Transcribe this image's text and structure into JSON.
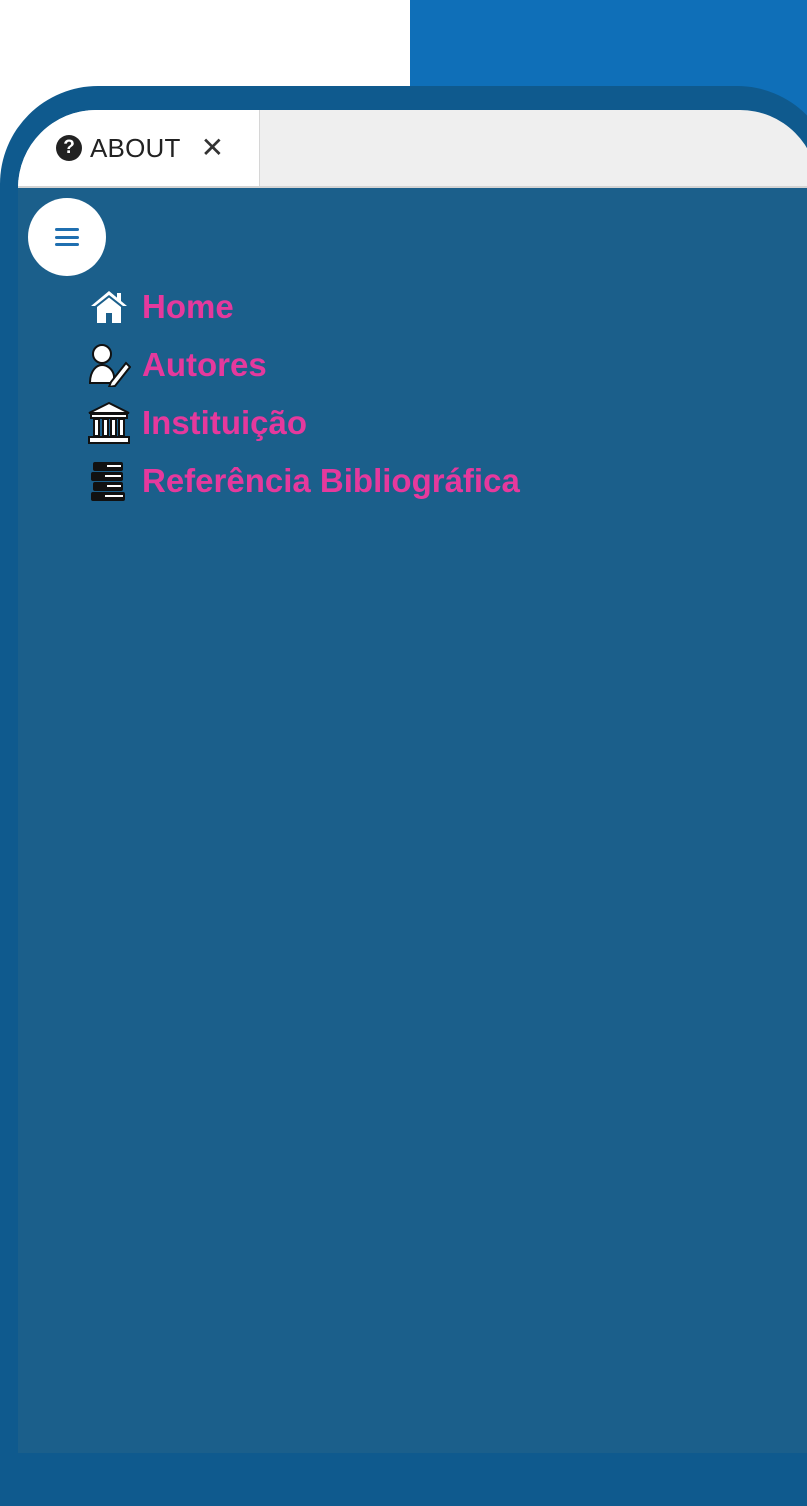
{
  "tabs": [
    {
      "label": "ABOUT",
      "icon": "question-circle-icon",
      "close_icon": "close-icon"
    }
  ],
  "menu": {
    "toggle_icon": "hamburger-menu-icon",
    "items": [
      {
        "label": "Home",
        "icon": "home-icon"
      },
      {
        "label": "Autores",
        "icon": "author-edit-icon"
      },
      {
        "label": "Instituição",
        "icon": "institution-icon"
      },
      {
        "label": "Referência Bibliográfica",
        "icon": "books-icon"
      }
    ]
  },
  "colors": {
    "page_background": "#ffffff",
    "background_accent": "#0f6fb8",
    "device_frame": "#0f5a8e",
    "screen_background": "#1b5f8b",
    "tab_bar_background": "#efefef",
    "link_color": "#e5399d",
    "hamburger_line_color": "#1f6fb0"
  }
}
